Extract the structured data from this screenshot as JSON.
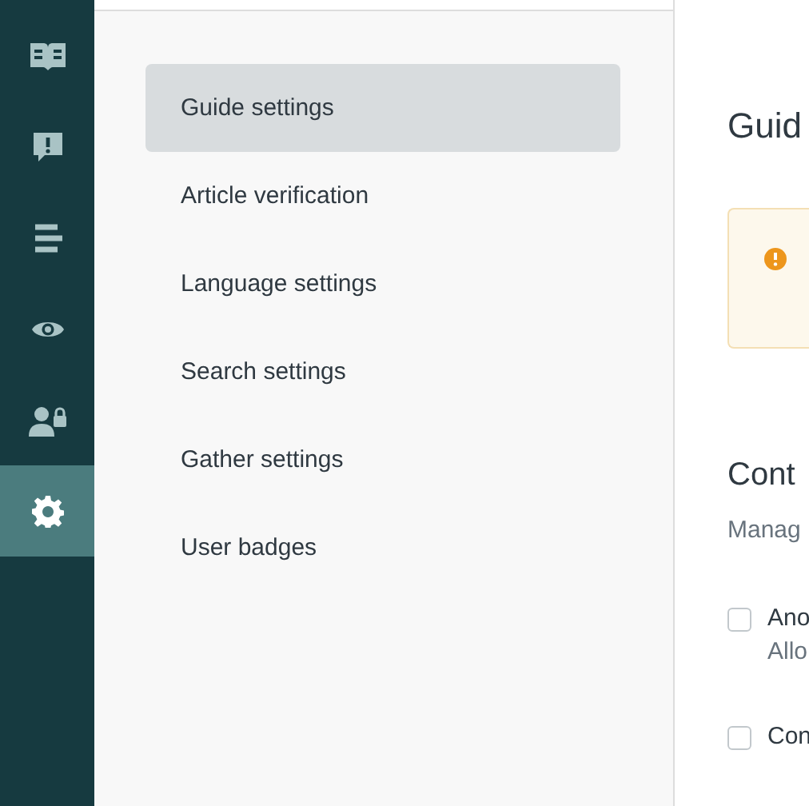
{
  "rail": {
    "items": [
      {
        "kind": "book",
        "selected": false
      },
      {
        "kind": "alert",
        "selected": false
      },
      {
        "kind": "lines",
        "selected": false
      },
      {
        "kind": "eye",
        "selected": false
      },
      {
        "kind": "user-lock",
        "selected": false
      },
      {
        "kind": "gear",
        "selected": true
      }
    ]
  },
  "settings_nav": {
    "items": [
      {
        "label": "Guide settings",
        "selected": true
      },
      {
        "label": "Article verification",
        "selected": false
      },
      {
        "label": "Language settings",
        "selected": false
      },
      {
        "label": "Search settings",
        "selected": false
      },
      {
        "label": "Gather settings",
        "selected": false
      },
      {
        "label": "User badges",
        "selected": false
      }
    ]
  },
  "content": {
    "title": "Guid",
    "notice": {
      "kind": "warning"
    },
    "section_title": "Cont",
    "section_description": "Manag",
    "options": [
      {
        "label": "Ano",
        "description": "Allo",
        "checked": false
      },
      {
        "label": "Con",
        "checked": false
      }
    ]
  }
}
